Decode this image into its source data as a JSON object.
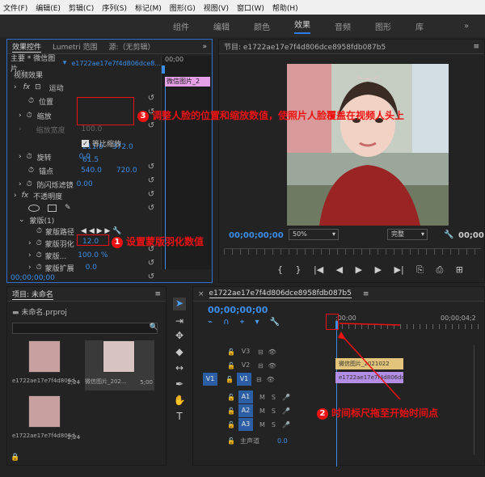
{
  "menu": [
    "文件(F)",
    "编辑(E)",
    "剪辑(C)",
    "序列(S)",
    "标记(M)",
    "图形(G)",
    "视图(V)",
    "窗口(W)",
    "帮助(H)"
  ],
  "workspace": {
    "tabs": [
      "组件",
      "编辑",
      "颜色",
      "效果",
      "音频",
      "图形",
      "库"
    ],
    "more": "»"
  },
  "effects": {
    "tabs": [
      "效果控件",
      "Lumetri 范围",
      "源:（无剪辑）"
    ],
    "clip_path": "主要 * 微信图片...",
    "seq_name": "e1722ae17e7f4d806dce8...",
    "time_start": "00;00",
    "clip_label": "微信图片_2",
    "video_effects": "视频效果",
    "motion": "运动",
    "position_label": "位置",
    "position_x": "211.0",
    "position_y": "372.0",
    "scale_label": "缩放",
    "scale_value": "61.5",
    "scale_width_label": "缩放宽度",
    "scale_width_value": "100.0",
    "uniform_scale": "等比缩放",
    "rotation_label": "旋转",
    "rotation_value": "0.0",
    "anchor_label": "锚点",
    "anchor_x": "540.0",
    "anchor_y": "720.0",
    "flicker_label": "防闪烁滤镜",
    "flicker_value": "0.00",
    "opacity_label": "不透明度",
    "mask_label": "蒙版(1)",
    "mask_path": "蒙版路径",
    "mask_feather": "蒙版羽化",
    "feather_value": "12.0",
    "mask_opacity": "蒙版...",
    "mask_opacity_value": "100.0 %",
    "mask_expand": "蒙版扩展",
    "expand_value": "0.0",
    "timecode": "00;00;00;00"
  },
  "program": {
    "title": "节目: e1722ae17e7f4d806dce8958fdb087b5",
    "timecode": "00;00;00;00",
    "zoom": "50%",
    "quality": "完整",
    "end_timecode": "00;00"
  },
  "project": {
    "title": "项目: 未命名",
    "file": "未命名.prproj",
    "items": [
      {
        "name": "e1722ae17e7f4d806d...",
        "duration": "2;24"
      },
      {
        "name": "微信图片_202...",
        "duration": "5;00"
      },
      {
        "name": "e1722ae17e7f4d806d...",
        "duration": "2;24"
      }
    ]
  },
  "timeline": {
    "title": "e1722ae17e7f4d806dce8958fdb087b5",
    "timecode": "00;00;00;00",
    "ruler_start": ";00;00",
    "ruler_end": "00;00;04;2",
    "tracks": [
      "V3",
      "V2",
      "V1",
      "A1",
      "A2",
      "A3"
    ],
    "master": "主声道",
    "master_value": "0.0",
    "clip_v2": "微信图片_2021022",
    "clip_v1": "e1722ae17e7f4d806dce"
  },
  "callouts": {
    "c1": "设置蒙版羽化数值",
    "c2": "时间标尺拖至开始时间点",
    "c3": "调整人脸的位置和缩放数值，使照片人脸覆盖在视频人头上"
  },
  "colors": {
    "accent": "#3b8ee8",
    "annotation": "#e11111",
    "clip_v1": "#b48ee6",
    "clip_v2": "#e2c57a"
  }
}
